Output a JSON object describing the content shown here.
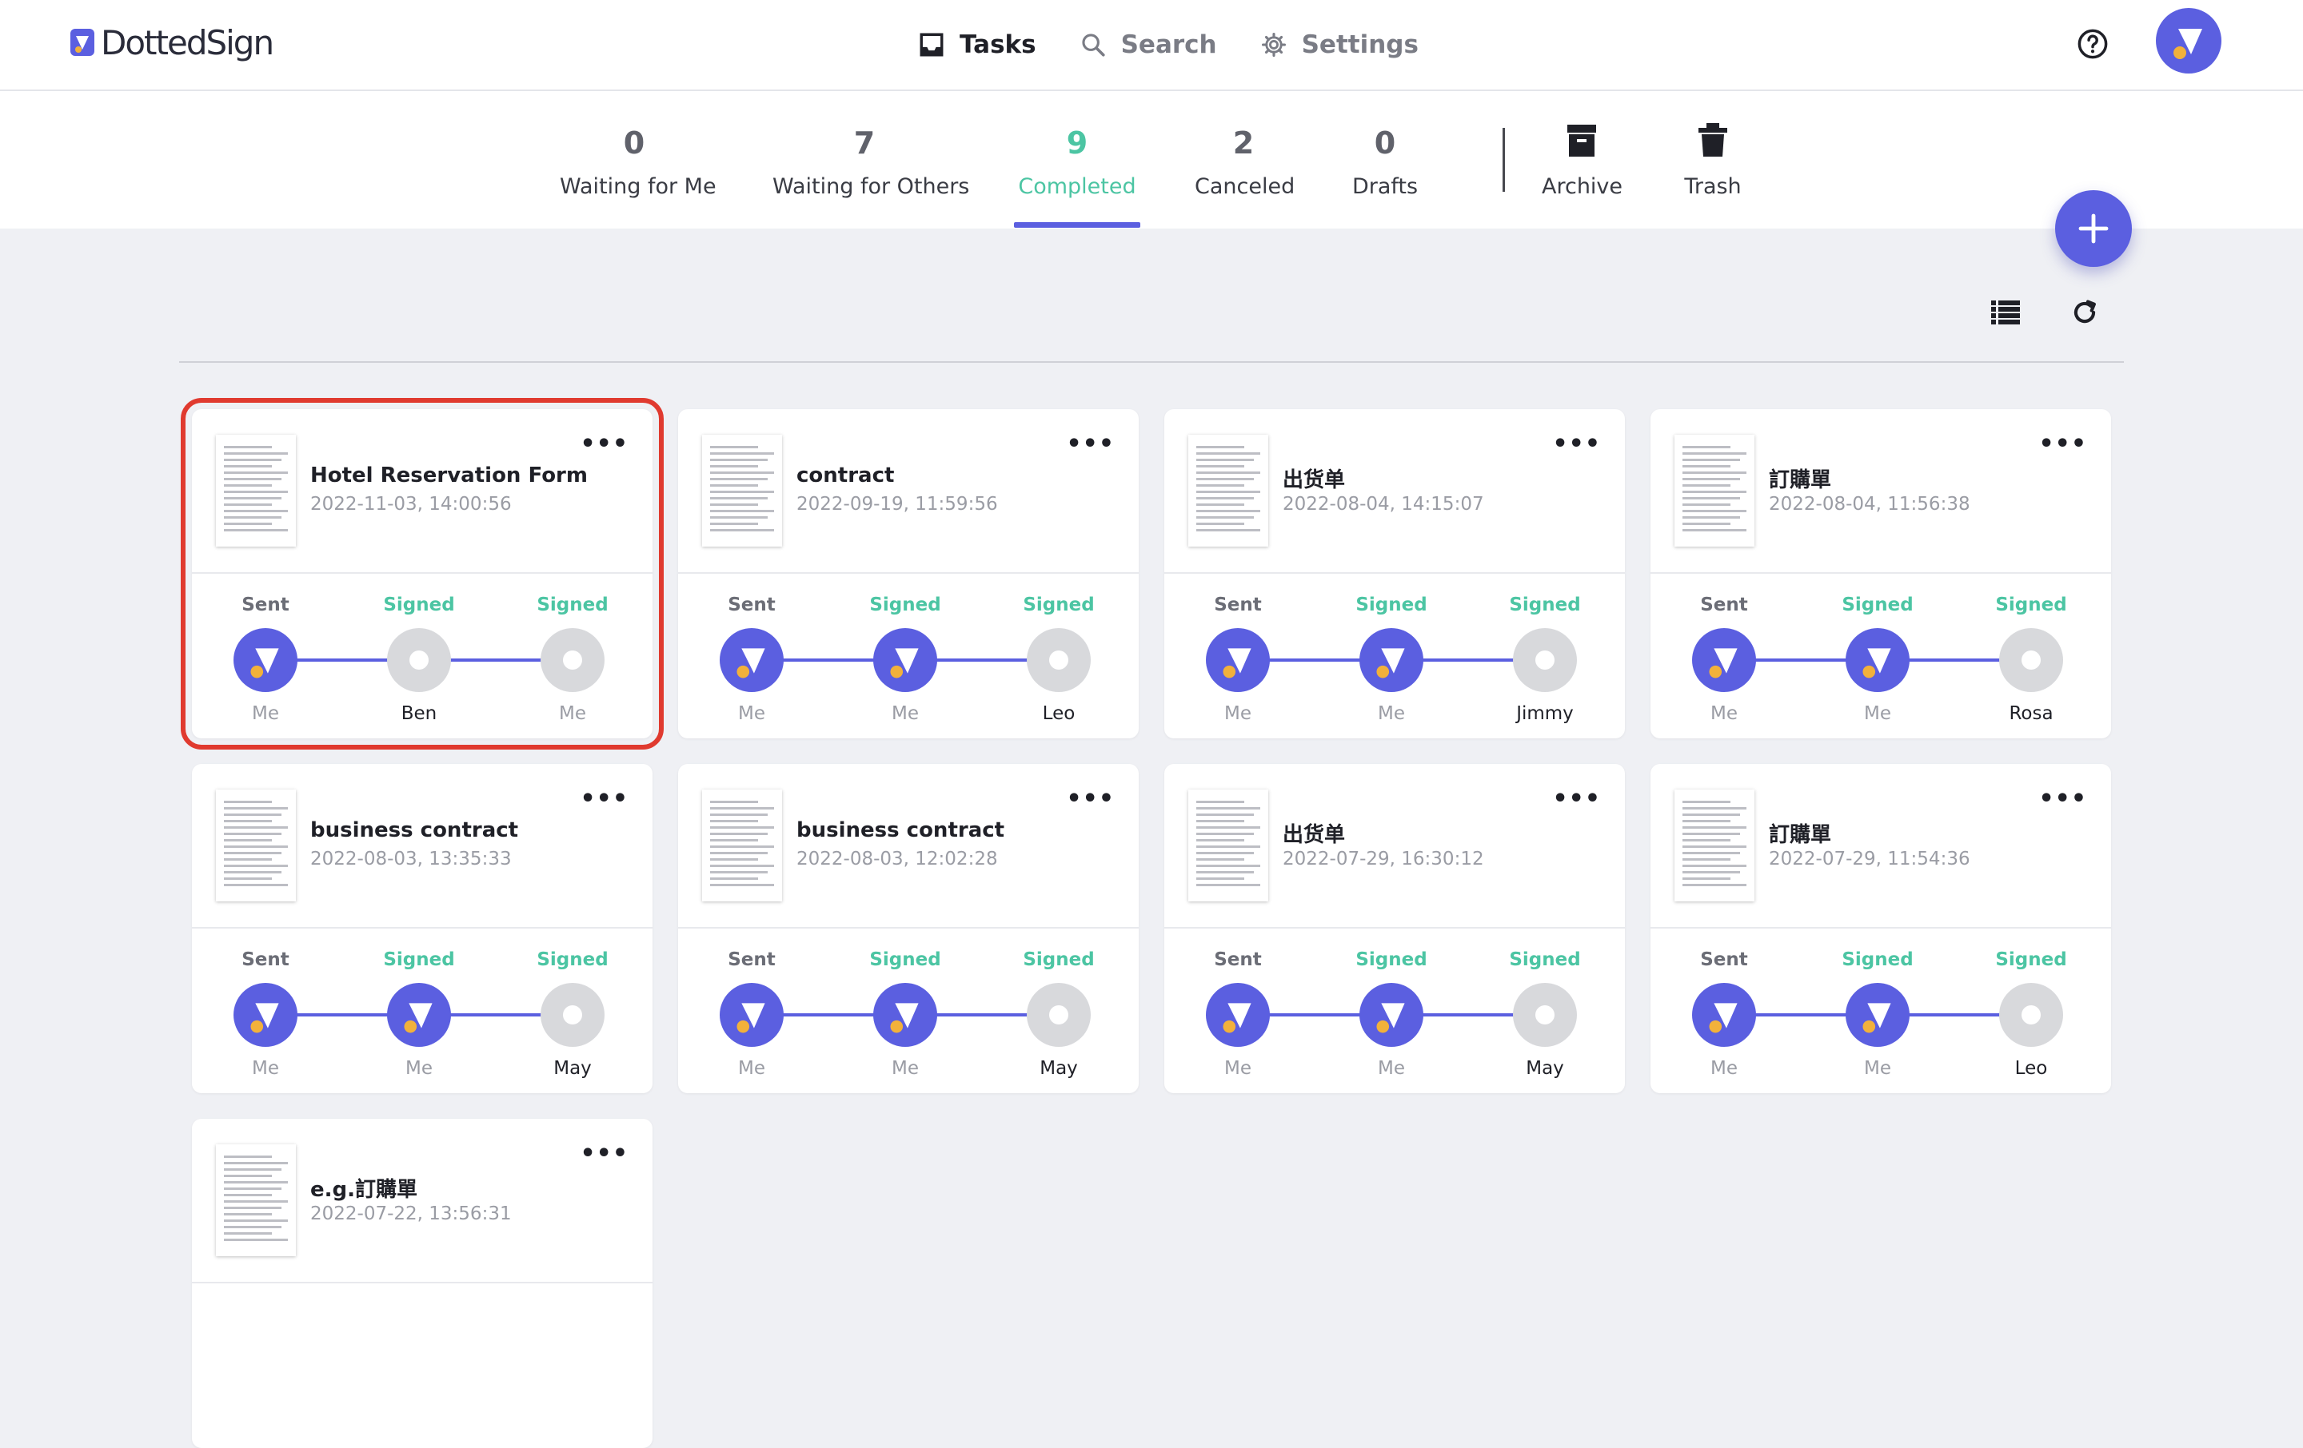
{
  "app": {
    "logo_text": "DottedSign",
    "brand_color": "#5b5fe0",
    "accent_color": "#4cc5a3",
    "highlight_color": "#e03a2f"
  },
  "nav": {
    "items": [
      {
        "label": "Tasks",
        "icon": "inbox-icon",
        "active": true
      },
      {
        "label": "Search",
        "icon": "search-icon",
        "active": false
      },
      {
        "label": "Settings",
        "icon": "gear-icon",
        "active": false
      }
    ],
    "help_icon": "help-circle-icon",
    "avatar_icon": "dottedsign-avatar-icon"
  },
  "tabs": [
    {
      "count": "0",
      "label": "Waiting for Me",
      "active": false
    },
    {
      "count": "7",
      "label": "Waiting for Others",
      "active": false
    },
    {
      "count": "9",
      "label": "Completed",
      "active": true
    },
    {
      "count": "2",
      "label": "Canceled",
      "active": false
    },
    {
      "count": "0",
      "label": "Drafts",
      "active": false
    },
    {
      "count": "",
      "label": "Archive",
      "icon": "archive-icon",
      "active": false
    },
    {
      "count": "",
      "label": "Trash",
      "icon": "trash-icon",
      "active": false
    }
  ],
  "toolbar": {
    "add_icon": "plus-icon",
    "list_view_icon": "list-view-icon",
    "refresh_icon": "refresh-icon"
  },
  "cards": [
    {
      "title": "Hotel Reservation Form",
      "date": "2022-11-03, 14:00:56",
      "more": "•••",
      "selected": true,
      "steps": [
        {
          "status": "Sent",
          "name": "Me",
          "done": true
        },
        {
          "status": "Signed",
          "name": "Ben",
          "done": false
        },
        {
          "status": "Signed",
          "name": "Me",
          "done": false
        }
      ]
    },
    {
      "title": "contract",
      "date": "2022-09-19, 11:59:56",
      "more": "•••",
      "selected": false,
      "steps": [
        {
          "status": "Sent",
          "name": "Me",
          "done": true
        },
        {
          "status": "Signed",
          "name": "Me",
          "done": true
        },
        {
          "status": "Signed",
          "name": "Leo",
          "done": false
        }
      ]
    },
    {
      "title": "出货单",
      "date": "2022-08-04, 14:15:07",
      "more": "•••",
      "selected": false,
      "steps": [
        {
          "status": "Sent",
          "name": "Me",
          "done": true
        },
        {
          "status": "Signed",
          "name": "Me",
          "done": true
        },
        {
          "status": "Signed",
          "name": "Jimmy",
          "done": false
        }
      ]
    },
    {
      "title": "訂購單",
      "date": "2022-08-04, 11:56:38",
      "more": "•••",
      "selected": false,
      "steps": [
        {
          "status": "Sent",
          "name": "Me",
          "done": true
        },
        {
          "status": "Signed",
          "name": "Me",
          "done": true
        },
        {
          "status": "Signed",
          "name": "Rosa",
          "done": false
        }
      ]
    },
    {
      "title": "business contract",
      "date": "2022-08-03, 13:35:33",
      "more": "•••",
      "selected": false,
      "steps": [
        {
          "status": "Sent",
          "name": "Me",
          "done": true
        },
        {
          "status": "Signed",
          "name": "Me",
          "done": true
        },
        {
          "status": "Signed",
          "name": "May",
          "done": false
        }
      ]
    },
    {
      "title": "business contract",
      "date": "2022-08-03, 12:02:28",
      "more": "•••",
      "selected": false,
      "steps": [
        {
          "status": "Sent",
          "name": "Me",
          "done": true
        },
        {
          "status": "Signed",
          "name": "Me",
          "done": true
        },
        {
          "status": "Signed",
          "name": "May",
          "done": false
        }
      ]
    },
    {
      "title": "出货单",
      "date": "2022-07-29, 16:30:12",
      "more": "•••",
      "selected": false,
      "steps": [
        {
          "status": "Sent",
          "name": "Me",
          "done": true
        },
        {
          "status": "Signed",
          "name": "Me",
          "done": true
        },
        {
          "status": "Signed",
          "name": "May",
          "done": false
        }
      ]
    },
    {
      "title": "訂購單",
      "date": "2022-07-29, 11:54:36",
      "more": "•••",
      "selected": false,
      "steps": [
        {
          "status": "Sent",
          "name": "Me",
          "done": true
        },
        {
          "status": "Signed",
          "name": "Me",
          "done": true
        },
        {
          "status": "Signed",
          "name": "Leo",
          "done": false
        }
      ]
    },
    {
      "title": "e.g.訂購單",
      "date": "2022-07-22, 13:56:31",
      "more": "•••",
      "selected": false,
      "steps": []
    }
  ]
}
